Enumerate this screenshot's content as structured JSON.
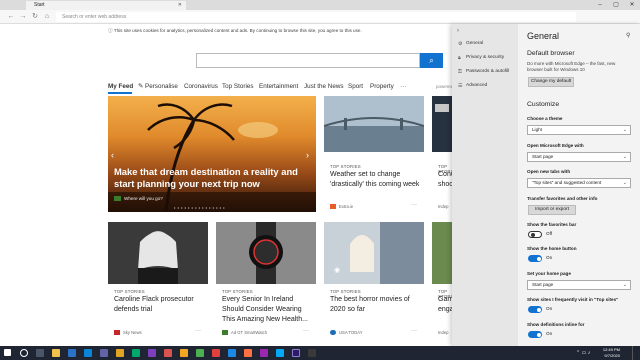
{
  "browser": {
    "tab_title": "Start",
    "address_placeholder": "Search or enter web address"
  },
  "cookie_notice": "This site uses cookies for analytics, personalized content and ads. By continuing to browse this site, you agree to this use.",
  "nav": {
    "items": [
      "My Feed",
      "Personalise",
      "Coronavirus",
      "Top Stories",
      "Entertainment",
      "Just the News",
      "Sport",
      "Property",
      "···"
    ],
    "powered": "powered"
  },
  "hero": {
    "title": "Make that dream destination a reality and start planning your next trip now",
    "source": "Where will you go?",
    "dots": "• • • • • • • • • • • • • • •"
  },
  "cards": [
    {
      "label": "TOP STORIES",
      "title": "Weather set to change 'drastically' this coming week",
      "source": "Extra.ie",
      "more": "···"
    },
    {
      "label": "TOP STORIES",
      "title": "Cono shoc",
      "source": "Indep",
      "more": ""
    },
    {
      "label": "TOP STORIES",
      "title": "Caroline Flack prosecutor defends trial",
      "source": "Sky News",
      "more": "···"
    },
    {
      "label": "TOP STORIES",
      "title": "Every Senior In Ireland Should Consider Wearing This Amazing New Health...",
      "source": "Ad   GT SmartWatch",
      "more": "···"
    },
    {
      "label": "TOP STORIES",
      "title": "The best horror movies of 2020 so far",
      "source": "USA TODAY",
      "more": "···"
    },
    {
      "label": "TOP STORIES",
      "title": "Garra engag",
      "source": "Indep",
      "more": ""
    }
  ],
  "settings": {
    "sidebar": [
      "General",
      "Privacy & security",
      "Passwords & autofill",
      "Advanced"
    ],
    "title": "General",
    "default_browser": {
      "heading": "Default browser",
      "text": "Do more with Microsoft Edge – the fast, new browser built for Windows 10",
      "button": "Change my default"
    },
    "customize": "Customize",
    "theme": {
      "label": "Choose a theme",
      "value": "Light"
    },
    "open_with": {
      "label": "Open Microsoft Edge with",
      "value": "Start page"
    },
    "new_tabs": {
      "label": "Open new tabs with",
      "value": "\"Top sites\" and suggested content"
    },
    "transfer": {
      "label": "Transfer favorites and other info",
      "button": "Import or export"
    },
    "favorites_bar": {
      "label": "Show the favorites bar",
      "state": "Off"
    },
    "home_button": {
      "label": "Show the home button",
      "state": "On"
    },
    "home_page": {
      "label": "Set your home page",
      "value": "Start page"
    },
    "top_sites": {
      "label": "Show sites I frequently visit in \"Top sites\"",
      "state": "On"
    },
    "definitions": {
      "label": "Show definitions inline for",
      "state": "On"
    }
  },
  "taskbar": {
    "time": "12:49 PM",
    "date": "9/7/2020"
  },
  "colors": {
    "accent": "#1173cf",
    "panel": "#f3f3f3",
    "taskbar": "#1f2532"
  }
}
